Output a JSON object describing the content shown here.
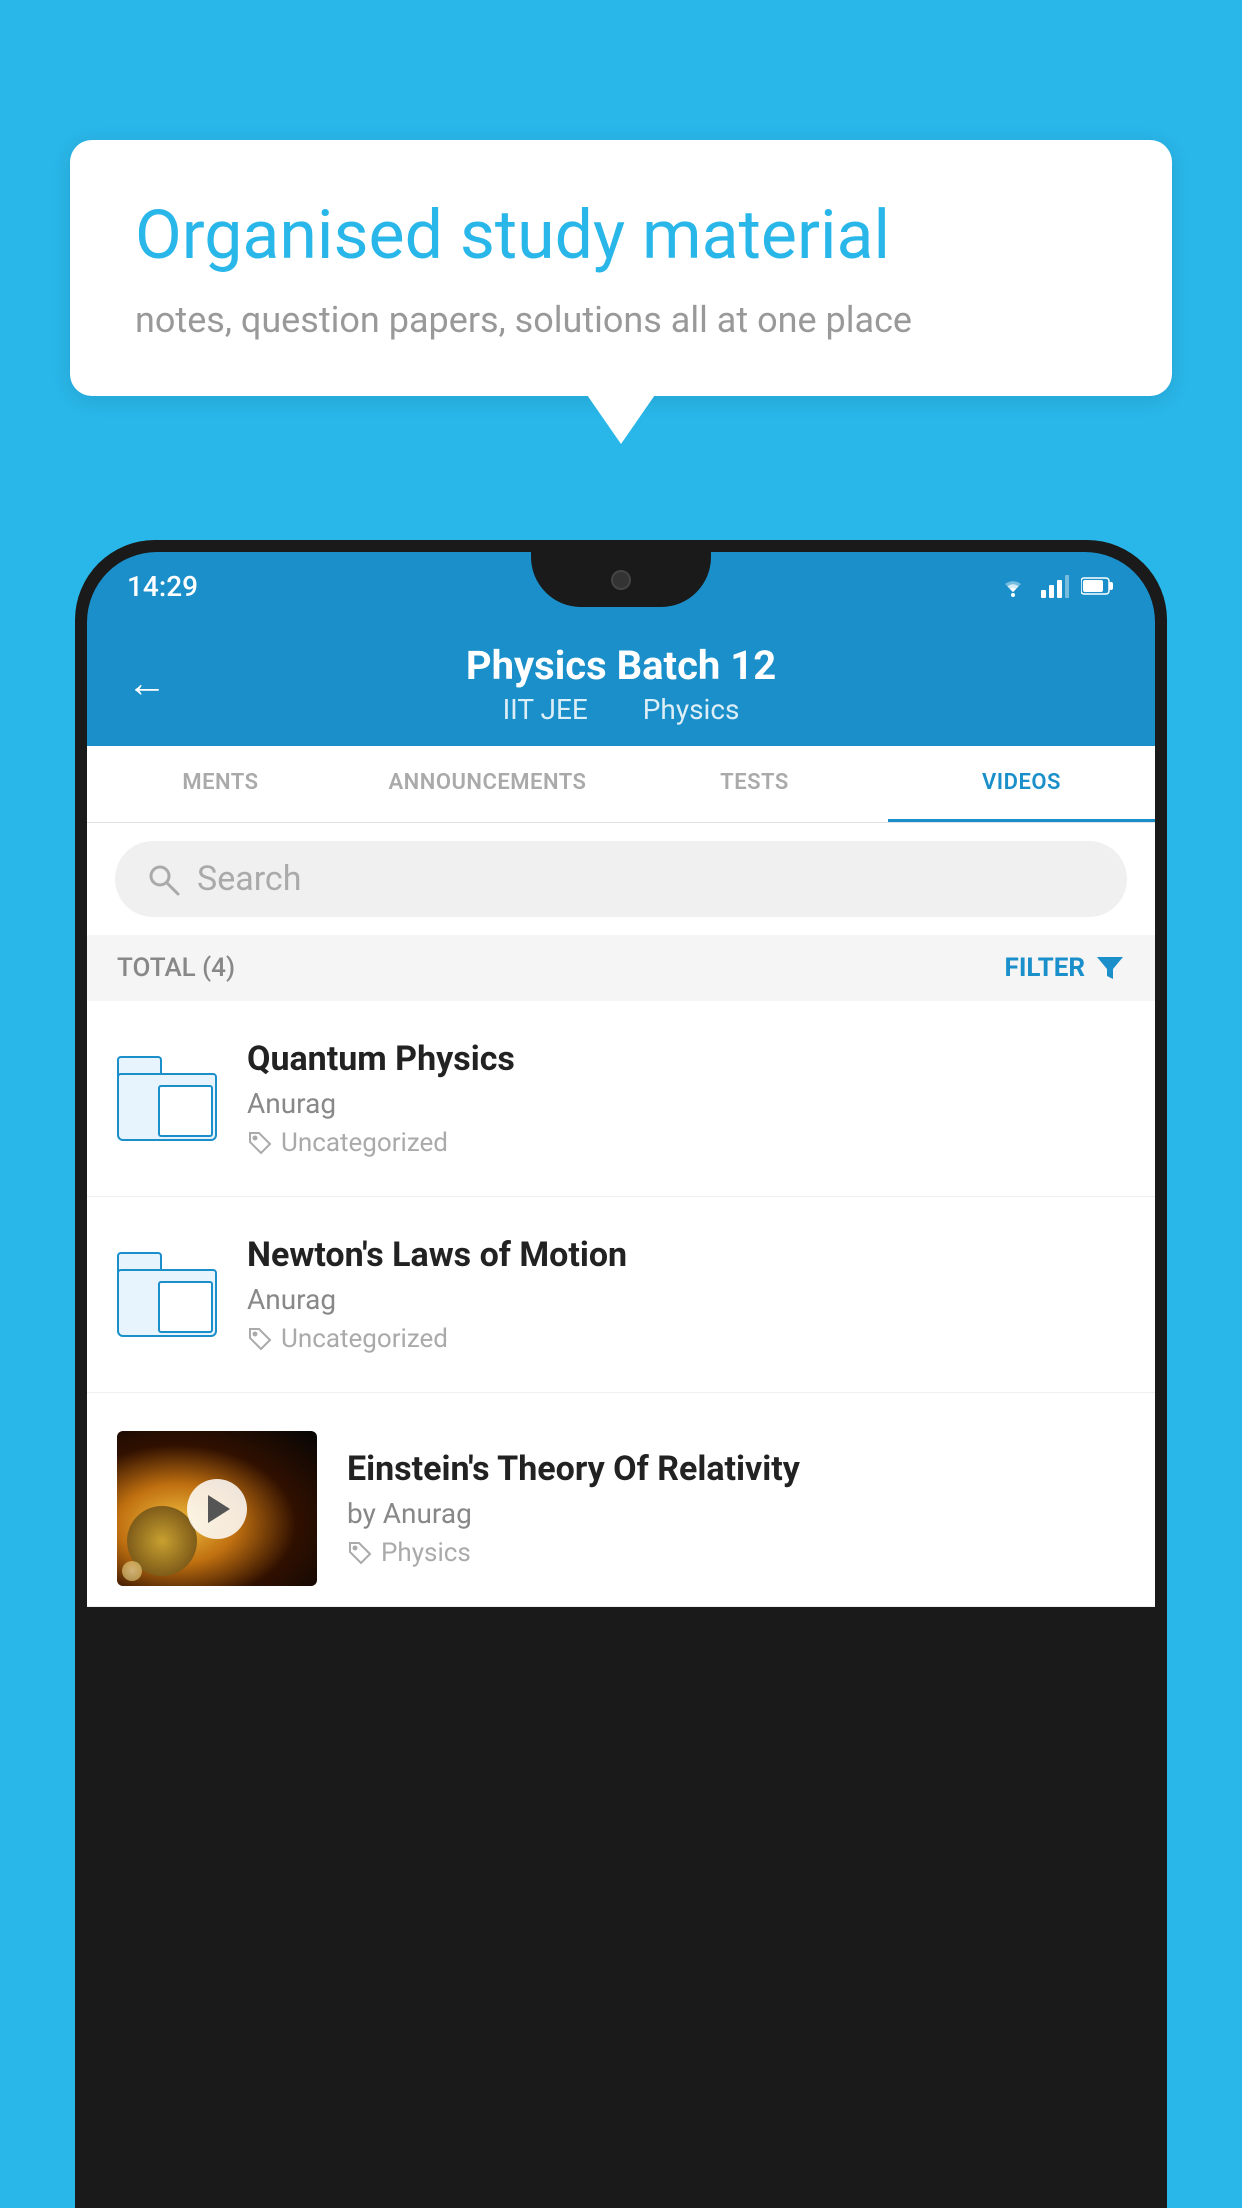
{
  "background_color": "#29b6e8",
  "hero": {
    "bubble_title": "Organised study material",
    "bubble_subtitle": "notes, question papers, solutions all at one place"
  },
  "phone": {
    "status_bar": {
      "time": "14:29"
    },
    "header": {
      "title": "Physics Batch 12",
      "subtitle_part1": "IIT JEE",
      "subtitle_part2": "Physics",
      "back_label": "←"
    },
    "tabs": [
      {
        "label": "MENTS",
        "active": false
      },
      {
        "label": "ANNOUNCEMENTS",
        "active": false
      },
      {
        "label": "TESTS",
        "active": false
      },
      {
        "label": "VIDEOS",
        "active": true
      }
    ],
    "search": {
      "placeholder": "Search"
    },
    "filter": {
      "total_label": "TOTAL (4)",
      "filter_label": "FILTER"
    },
    "videos": [
      {
        "title": "Quantum Physics",
        "author": "Anurag",
        "tag": "Uncategorized",
        "type": "folder",
        "has_thumbnail": false
      },
      {
        "title": "Newton's Laws of Motion",
        "author": "Anurag",
        "tag": "Uncategorized",
        "type": "folder",
        "has_thumbnail": false
      },
      {
        "title": "Einstein's Theory Of Relativity",
        "author": "by Anurag",
        "tag": "Physics",
        "type": "video",
        "has_thumbnail": true
      }
    ]
  }
}
